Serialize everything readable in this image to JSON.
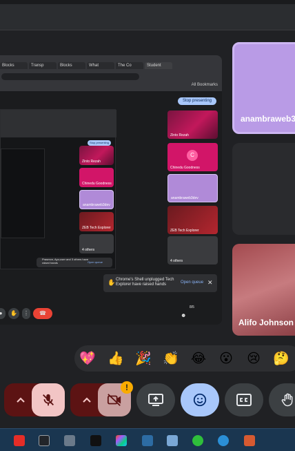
{
  "stage": {
    "tabs": [
      "Blocks",
      "Transp",
      "Blocks",
      "What",
      "The Co",
      "Student"
    ],
    "bookmarks_label": "All Bookmarks",
    "stop_presenting_label": "Stop presenting",
    "nested_stop_label": "Stop presenting",
    "toast": {
      "message": "Chrome's Shell unplugged Tech Explorer have raised hands",
      "action": "Open queue"
    },
    "nested_toast": {
      "message": "Prasmon, Ayo-user and 3 others have raised hands",
      "action": "Open queue"
    },
    "thumbs": [
      {
        "caption": "Zinto Rezah"
      },
      {
        "caption": "Chinedu Goodness"
      },
      {
        "caption": "anambraweb3dev"
      },
      {
        "caption": "ZEB Tech Explorer"
      },
      {
        "caption": "4 others"
      }
    ],
    "nested_thumbs": [
      {
        "caption": "Zinto Rezah"
      },
      {
        "caption": "Chinedu Goodness"
      },
      {
        "caption": "anambraweb3dev"
      },
      {
        "caption": "ZEB Tech Explorer"
      },
      {
        "caption": "4 others"
      }
    ],
    "people_count": "8/5",
    "avatar_letter": "C"
  },
  "participants": [
    {
      "name": "anambraweb3"
    },
    {
      "name": ""
    },
    {
      "name": "Alifo Johnson"
    }
  ],
  "reactions": [
    "💖",
    "👍",
    "🎉",
    "👏",
    "😂",
    "😮",
    "😢",
    "🤔"
  ],
  "controls": {
    "mic_badge": "!",
    "colors": {
      "danger": "#5c1313",
      "accent": "#a8c7fa",
      "warning": "#f9ab00"
    }
  },
  "taskbar": {
    "icons": [
      "youtube-icon",
      "ai-app-icon",
      "calculator-icon",
      "terminal-icon",
      "figma-icon",
      "keyboard-icon",
      "paint-icon",
      "phone-icon",
      "eye-icon",
      "office-icon"
    ]
  }
}
